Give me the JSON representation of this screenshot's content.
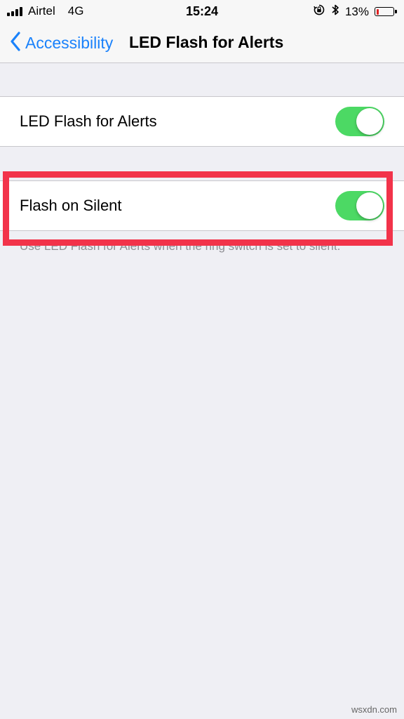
{
  "status_bar": {
    "carrier": "Airtel",
    "network": "4G",
    "time": "15:24",
    "battery_percent": "13%",
    "battery_level": 0.13,
    "icons": [
      "signal-icon",
      "rotation-lock-icon",
      "bluetooth-icon",
      "battery-icon"
    ]
  },
  "nav": {
    "back_label": "Accessibility",
    "title": "LED Flash for Alerts"
  },
  "settings": {
    "led_flash": {
      "label": "LED Flash for Alerts",
      "enabled": true
    },
    "flash_on_silent": {
      "label": "Flash on Silent",
      "enabled": true,
      "footer": "Use LED Flash for Alerts when the ring switch is set to silent."
    }
  },
  "colors": {
    "accent": "#1a82fb",
    "toggle_on": "#4cd964",
    "highlight": "#f2334a",
    "background": "#efeff4"
  },
  "watermark": "wsxdn.com"
}
